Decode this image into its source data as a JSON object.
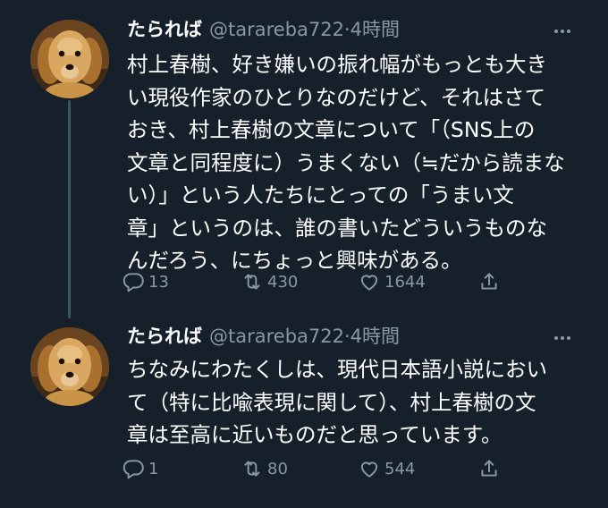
{
  "tweets": [
    {
      "display_name": "たられば",
      "handle": "@tarareba722",
      "separator": "·",
      "time": "4時間",
      "text": "村上春樹、好き嫌いの振れ幅がもっとも大き\nい現役作家のひとりなのだけど、それはさて\nおき、村上春樹の文章について「（SNS上の\n文章と同程度に）うまくない（≒だから読まな\nい）」という人たちにとっての「うまい文\n章」というのは、誰の書いたどういうものな\nんだろう、にちょっと興味がある。",
      "reply_count": "13",
      "retweet_count": "430",
      "like_count": "1644"
    },
    {
      "display_name": "たられば",
      "handle": "@tarareba722",
      "separator": "·",
      "time": "4時間",
      "text": "ちなみにわたくしは、現代日本語小説におい\nて（特に比喩表現に関して）、村上春樹の文\n章は至高に近いものだと思っています。",
      "reply_count": "1",
      "retweet_count": "80",
      "like_count": "544"
    }
  ],
  "icons": {
    "avatar": "golden-retriever-avatar",
    "more": "more-horizontal-icon",
    "reply": "reply-icon",
    "retweet": "retweet-icon",
    "like": "heart-icon",
    "share": "share-icon"
  },
  "colors": {
    "background": "#15202b",
    "text": "#ffffff",
    "secondary": "#8899a6",
    "thread_line": "#3d5466"
  }
}
